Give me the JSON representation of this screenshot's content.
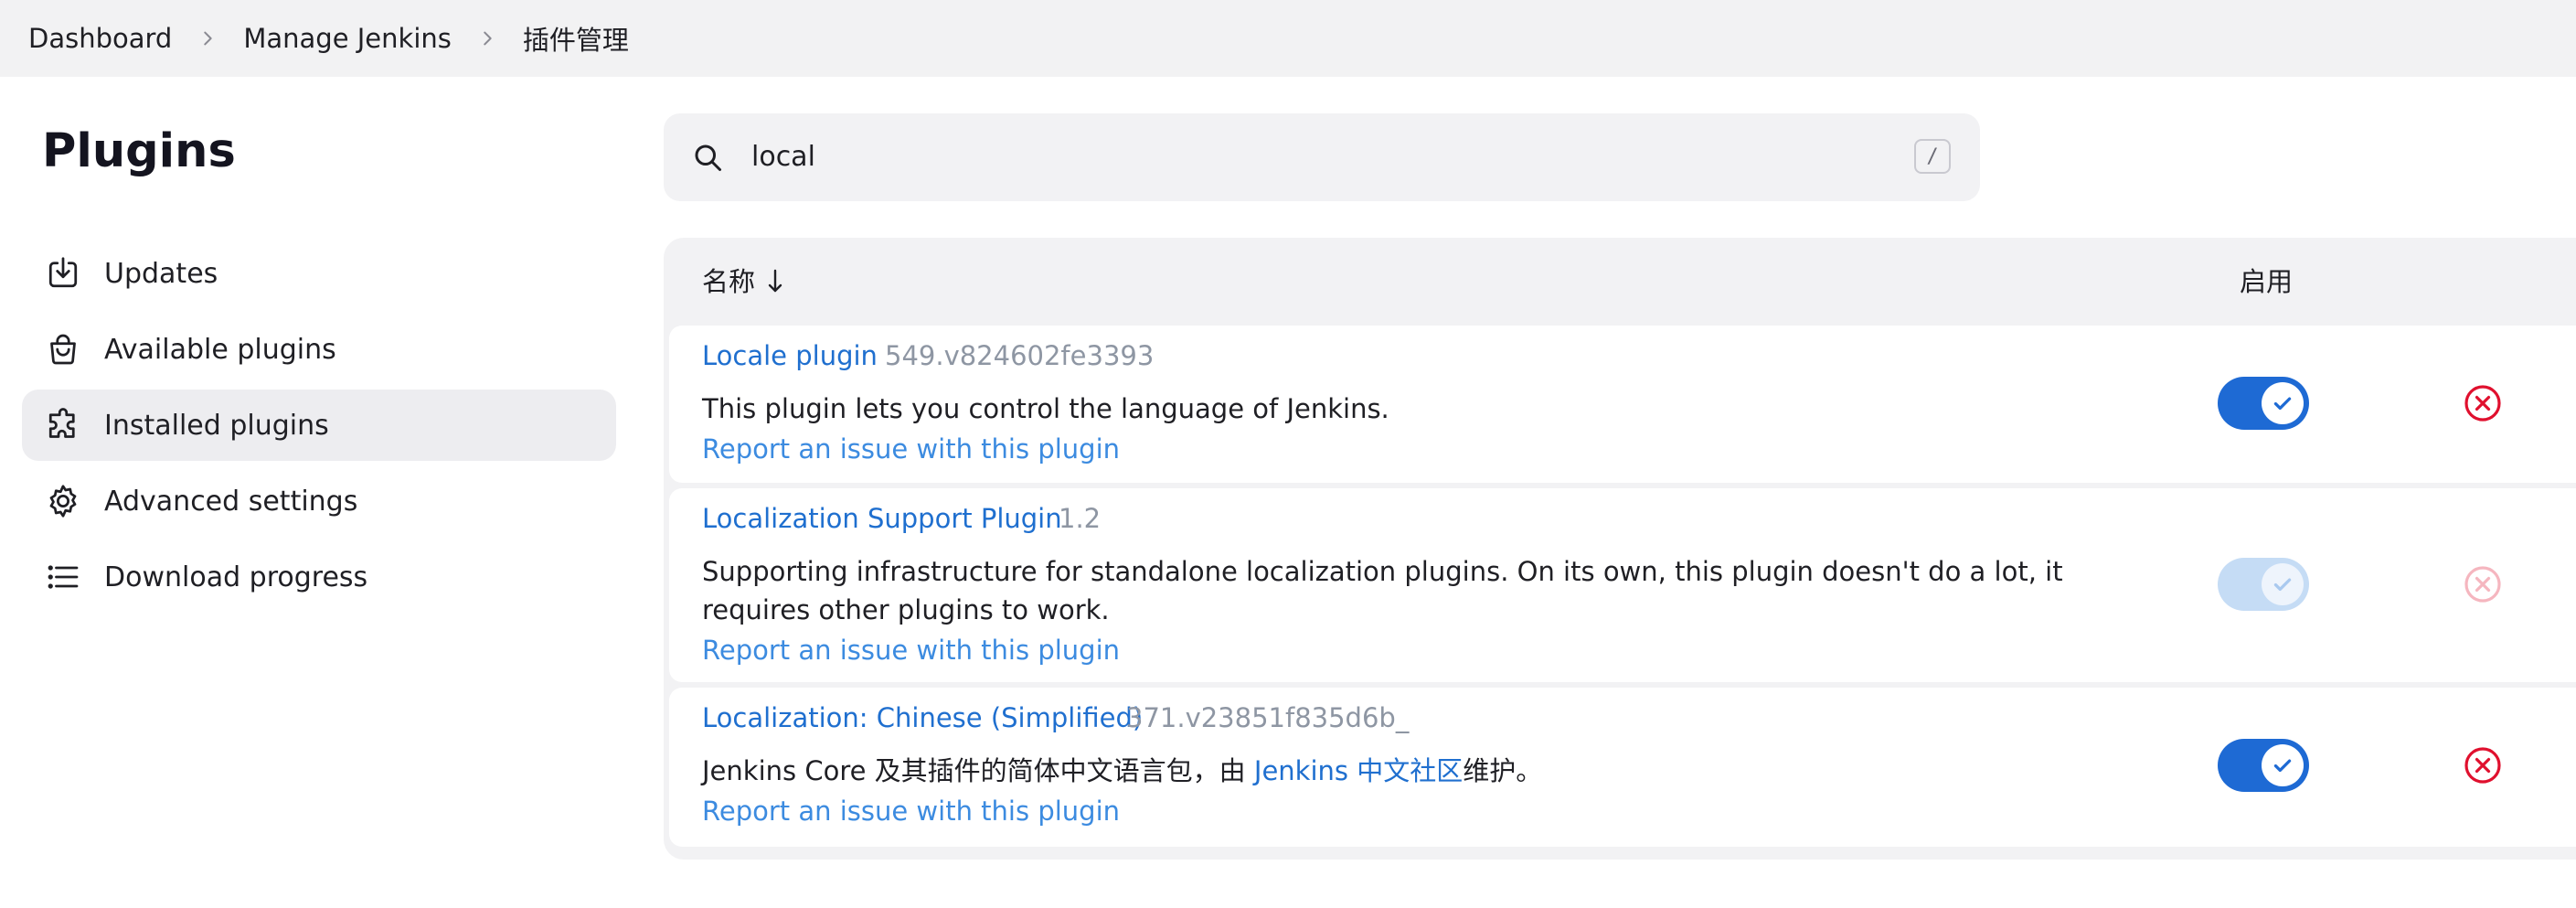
{
  "breadcrumb": {
    "items": [
      "Dashboard",
      "Manage Jenkins",
      "插件管理"
    ]
  },
  "page": {
    "title": "Plugins"
  },
  "sidebar": {
    "items": [
      {
        "label": "Updates",
        "icon": "download-icon",
        "active": false
      },
      {
        "label": "Available plugins",
        "icon": "shopping-bag-icon",
        "active": false
      },
      {
        "label": "Installed plugins",
        "icon": "puzzle-icon",
        "active": true
      },
      {
        "label": "Advanced settings",
        "icon": "gear-icon",
        "active": false
      },
      {
        "label": "Download progress",
        "icon": "list-icon",
        "active": false
      }
    ]
  },
  "search": {
    "value": "local",
    "shortcut": "/"
  },
  "table": {
    "header_name": "名称",
    "sort_icon": "arrow-down-icon",
    "header_enable": "启用",
    "rows": [
      {
        "name": "Locale plugin",
        "version": "549.v824602fe3393",
        "description": "This plugin lets you control the language of Jenkins.",
        "report": "Report an issue with this plugin",
        "enabled": true,
        "toggle_disabled": false,
        "uninstall_disabled": false
      },
      {
        "name": "Localization Support Plugin",
        "version": "1.2",
        "description": "Supporting infrastructure for standalone localization plugins. On its own, this plugin doesn't do a lot, it requires other plugins to work.",
        "report": "Report an issue with this plugin",
        "enabled": true,
        "toggle_disabled": true,
        "uninstall_disabled": true
      },
      {
        "name": "Localization: Chinese (Simplified)",
        "version": "371.v23851f835d6b_",
        "description_prefix": "Jenkins Core 及其插件的简体中文语言包，由 ",
        "description_link": "Jenkins 中文社区",
        "description_suffix": "维护。",
        "report": "Report an issue with this plugin",
        "enabled": true,
        "toggle_disabled": false,
        "uninstall_disabled": false
      }
    ]
  },
  "colors": {
    "link": "#1f6fcf",
    "toggle_on": "#1e6ad4",
    "danger": "#e0102e"
  }
}
